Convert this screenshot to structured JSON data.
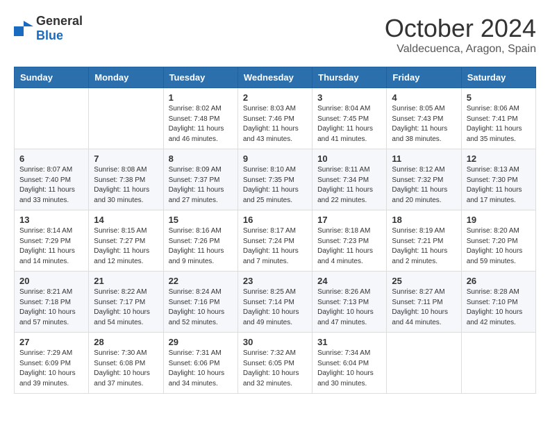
{
  "logo": {
    "general": "General",
    "blue": "Blue"
  },
  "header": {
    "month": "October 2024",
    "location": "Valdecuenca, Aragon, Spain"
  },
  "weekdays": [
    "Sunday",
    "Monday",
    "Tuesday",
    "Wednesday",
    "Thursday",
    "Friday",
    "Saturday"
  ],
  "weeks": [
    [
      {
        "day": "",
        "info": ""
      },
      {
        "day": "",
        "info": ""
      },
      {
        "day": "1",
        "info": "Sunrise: 8:02 AM\nSunset: 7:48 PM\nDaylight: 11 hours and 46 minutes."
      },
      {
        "day": "2",
        "info": "Sunrise: 8:03 AM\nSunset: 7:46 PM\nDaylight: 11 hours and 43 minutes."
      },
      {
        "day": "3",
        "info": "Sunrise: 8:04 AM\nSunset: 7:45 PM\nDaylight: 11 hours and 41 minutes."
      },
      {
        "day": "4",
        "info": "Sunrise: 8:05 AM\nSunset: 7:43 PM\nDaylight: 11 hours and 38 minutes."
      },
      {
        "day": "5",
        "info": "Sunrise: 8:06 AM\nSunset: 7:41 PM\nDaylight: 11 hours and 35 minutes."
      }
    ],
    [
      {
        "day": "6",
        "info": "Sunrise: 8:07 AM\nSunset: 7:40 PM\nDaylight: 11 hours and 33 minutes."
      },
      {
        "day": "7",
        "info": "Sunrise: 8:08 AM\nSunset: 7:38 PM\nDaylight: 11 hours and 30 minutes."
      },
      {
        "day": "8",
        "info": "Sunrise: 8:09 AM\nSunset: 7:37 PM\nDaylight: 11 hours and 27 minutes."
      },
      {
        "day": "9",
        "info": "Sunrise: 8:10 AM\nSunset: 7:35 PM\nDaylight: 11 hours and 25 minutes."
      },
      {
        "day": "10",
        "info": "Sunrise: 8:11 AM\nSunset: 7:34 PM\nDaylight: 11 hours and 22 minutes."
      },
      {
        "day": "11",
        "info": "Sunrise: 8:12 AM\nSunset: 7:32 PM\nDaylight: 11 hours and 20 minutes."
      },
      {
        "day": "12",
        "info": "Sunrise: 8:13 AM\nSunset: 7:30 PM\nDaylight: 11 hours and 17 minutes."
      }
    ],
    [
      {
        "day": "13",
        "info": "Sunrise: 8:14 AM\nSunset: 7:29 PM\nDaylight: 11 hours and 14 minutes."
      },
      {
        "day": "14",
        "info": "Sunrise: 8:15 AM\nSunset: 7:27 PM\nDaylight: 11 hours and 12 minutes."
      },
      {
        "day": "15",
        "info": "Sunrise: 8:16 AM\nSunset: 7:26 PM\nDaylight: 11 hours and 9 minutes."
      },
      {
        "day": "16",
        "info": "Sunrise: 8:17 AM\nSunset: 7:24 PM\nDaylight: 11 hours and 7 minutes."
      },
      {
        "day": "17",
        "info": "Sunrise: 8:18 AM\nSunset: 7:23 PM\nDaylight: 11 hours and 4 minutes."
      },
      {
        "day": "18",
        "info": "Sunrise: 8:19 AM\nSunset: 7:21 PM\nDaylight: 11 hours and 2 minutes."
      },
      {
        "day": "19",
        "info": "Sunrise: 8:20 AM\nSunset: 7:20 PM\nDaylight: 10 hours and 59 minutes."
      }
    ],
    [
      {
        "day": "20",
        "info": "Sunrise: 8:21 AM\nSunset: 7:18 PM\nDaylight: 10 hours and 57 minutes."
      },
      {
        "day": "21",
        "info": "Sunrise: 8:22 AM\nSunset: 7:17 PM\nDaylight: 10 hours and 54 minutes."
      },
      {
        "day": "22",
        "info": "Sunrise: 8:24 AM\nSunset: 7:16 PM\nDaylight: 10 hours and 52 minutes."
      },
      {
        "day": "23",
        "info": "Sunrise: 8:25 AM\nSunset: 7:14 PM\nDaylight: 10 hours and 49 minutes."
      },
      {
        "day": "24",
        "info": "Sunrise: 8:26 AM\nSunset: 7:13 PM\nDaylight: 10 hours and 47 minutes."
      },
      {
        "day": "25",
        "info": "Sunrise: 8:27 AM\nSunset: 7:11 PM\nDaylight: 10 hours and 44 minutes."
      },
      {
        "day": "26",
        "info": "Sunrise: 8:28 AM\nSunset: 7:10 PM\nDaylight: 10 hours and 42 minutes."
      }
    ],
    [
      {
        "day": "27",
        "info": "Sunrise: 7:29 AM\nSunset: 6:09 PM\nDaylight: 10 hours and 39 minutes."
      },
      {
        "day": "28",
        "info": "Sunrise: 7:30 AM\nSunset: 6:08 PM\nDaylight: 10 hours and 37 minutes."
      },
      {
        "day": "29",
        "info": "Sunrise: 7:31 AM\nSunset: 6:06 PM\nDaylight: 10 hours and 34 minutes."
      },
      {
        "day": "30",
        "info": "Sunrise: 7:32 AM\nSunset: 6:05 PM\nDaylight: 10 hours and 32 minutes."
      },
      {
        "day": "31",
        "info": "Sunrise: 7:34 AM\nSunset: 6:04 PM\nDaylight: 10 hours and 30 minutes."
      },
      {
        "day": "",
        "info": ""
      },
      {
        "day": "",
        "info": ""
      }
    ]
  ]
}
